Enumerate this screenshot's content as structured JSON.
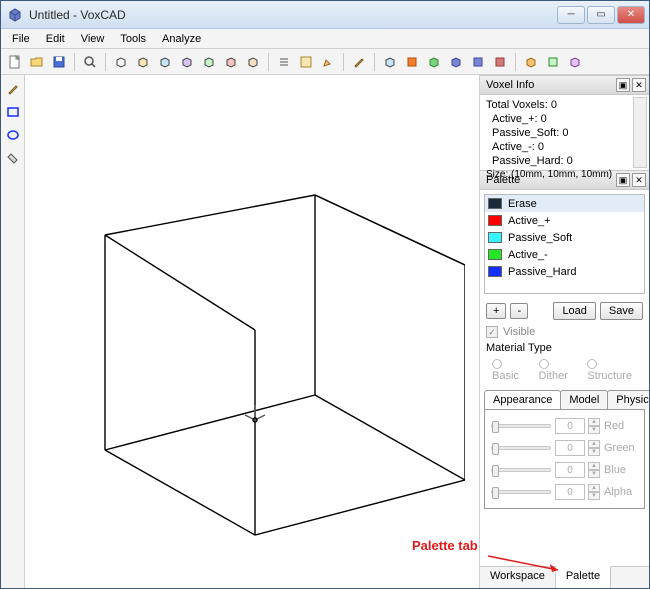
{
  "window": {
    "title": "Untitled - VoxCAD"
  },
  "menu": {
    "file": "File",
    "edit": "Edit",
    "view": "View",
    "tools": "Tools",
    "analyze": "Analyze"
  },
  "voxel_info": {
    "title": "Voxel Info",
    "lines": {
      "total": "Total Voxels: 0",
      "active_plus": "Active_+: 0",
      "passive_soft": "Passive_Soft: 0",
      "active_minus": "Active_-: 0",
      "passive_hard": "Passive_Hard: 0",
      "size": "Size: (10mm, 10mm, 10mm)"
    }
  },
  "palette": {
    "title": "Palette",
    "items": [
      {
        "label": "Erase",
        "color": "#1a2a3a"
      },
      {
        "label": "Active_+",
        "color": "#ff0000"
      },
      {
        "label": "Passive_Soft",
        "color": "#34f5ff"
      },
      {
        "label": "Active_-",
        "color": "#25e625"
      },
      {
        "label": "Passive_Hard",
        "color": "#1430ff"
      }
    ],
    "buttons": {
      "add": "+",
      "remove": "-",
      "load": "Load",
      "save": "Save"
    },
    "visible": "Visible",
    "material_type_label": "Material Type",
    "material_types": {
      "basic": "Basic",
      "dither": "Dither",
      "structure": "Structure"
    },
    "tabs": {
      "appearance": "Appearance",
      "model": "Model",
      "physical": "Physical"
    },
    "sliders": {
      "red": {
        "value": "0",
        "label": "Red"
      },
      "green": {
        "value": "0",
        "label": "Green"
      },
      "blue": {
        "value": "0",
        "label": "Blue"
      },
      "alpha": {
        "value": "0",
        "label": "Alpha"
      }
    },
    "bottom_tabs": {
      "workspace": "Workspace",
      "palette": "Palette"
    }
  },
  "annotation": {
    "text": "Palette tab"
  }
}
